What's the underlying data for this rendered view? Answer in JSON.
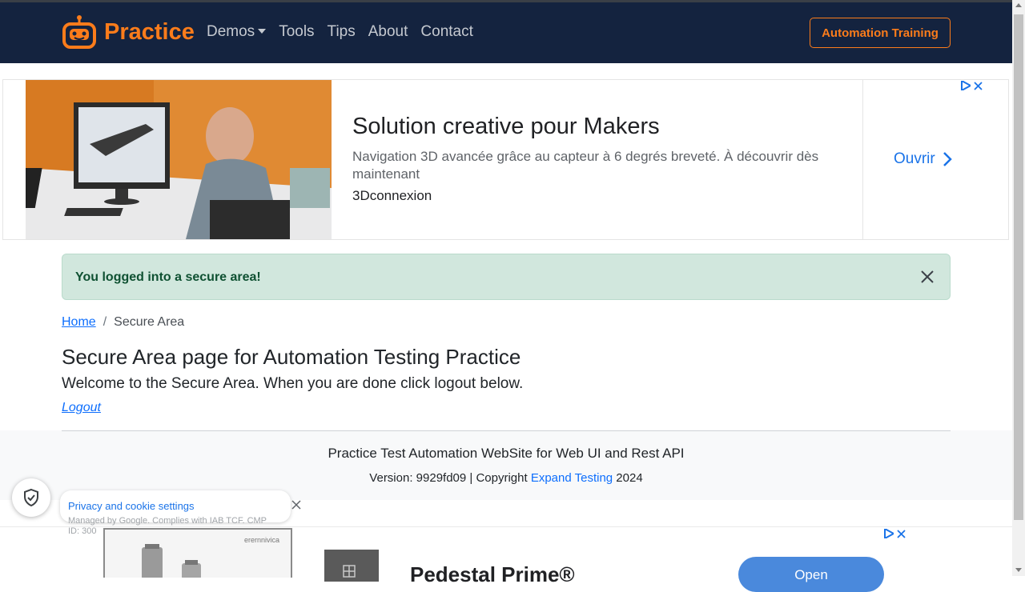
{
  "header": {
    "brand": "Practice",
    "nav": [
      {
        "label": "Demos",
        "has_dropdown": true
      },
      {
        "label": "Tools"
      },
      {
        "label": "Tips"
      },
      {
        "label": "About"
      },
      {
        "label": "Contact"
      }
    ],
    "cta": "Automation Training"
  },
  "ad_top": {
    "title": "Solution creative pour Makers",
    "description": "Navigation 3D avancée grâce au capteur à 6 degrés breveté. À découvrir dès maintenant",
    "advertiser": "3Dconnexion",
    "open_label": "Ouvrir"
  },
  "alert": {
    "message": "You logged into a secure area!",
    "color": "#d1e7dd"
  },
  "breadcrumb": {
    "home": "Home",
    "separator": "/",
    "current": "Secure Area"
  },
  "main": {
    "title": "Secure Area page for Automation Testing Practice",
    "welcome": "Welcome to the Secure Area. When you are done click logout below.",
    "logout": "Logout"
  },
  "footer": {
    "title": "Practice Test Automation WebSite for Web UI and Rest API",
    "version_prefix": "Version: 9929fd09 | Copyright ",
    "company": "Expand Testing",
    "year": " 2024"
  },
  "cookie": {
    "title": "Privacy and cookie settings",
    "subtitle": "Managed by Google. Complies with IAB TCF. CMP ID: 300"
  },
  "ad_bottom": {
    "brand": "erernnivica",
    "title": "Pedestal Prime®",
    "open_label": "Open"
  },
  "colors": {
    "navbar": "#14233f",
    "brand_orange": "#fb7c1b",
    "link_blue": "#0d6efd",
    "ad_blue": "#1a73e8"
  }
}
